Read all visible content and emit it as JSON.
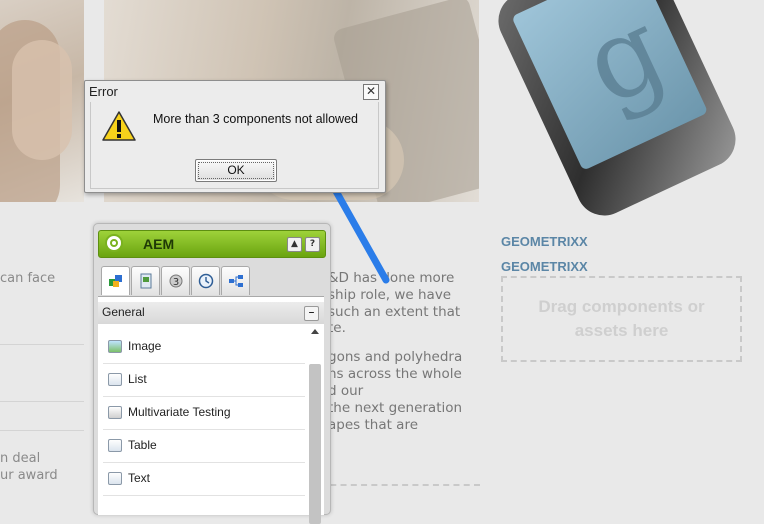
{
  "left_texts": [
    "can face",
    "n deal",
    "ur award"
  ],
  "body_fragments": [
    "&D has done more",
    "ship role, we have",
    " such an extent that",
    "te.",
    "gons and polyhedra",
    "ns across the whole",
    "d our",
    "the next generation",
    "apes that are"
  ],
  "links": [
    "GEOMETRIXX",
    "GEOMETRIXX"
  ],
  "dropzone": {
    "text": "Drag components or assets here"
  },
  "sidekick": {
    "title": "AEM",
    "header_up": "▲",
    "header_help": "?",
    "tabs": [
      "components-tab",
      "page-tab",
      "workflow-tab",
      "versioning-tab",
      "site-tab"
    ],
    "section": "General",
    "collapse": "–",
    "items": [
      {
        "label": "Image",
        "icon": "image-icon"
      },
      {
        "label": "List",
        "icon": "list-icon"
      },
      {
        "label": "Multivariate Testing",
        "icon": "multivariate-icon"
      },
      {
        "label": "Table",
        "icon": "table-icon"
      },
      {
        "label": "Text",
        "icon": "text-icon"
      }
    ]
  },
  "dialog": {
    "title": "Error",
    "close": "✕",
    "message": "More than 3 components not allowed",
    "ok": "OK"
  },
  "colors": {
    "accent_green": "#7ab21f",
    "link_blue": "#5b86a6",
    "arrow_blue": "#2b7de9"
  }
}
